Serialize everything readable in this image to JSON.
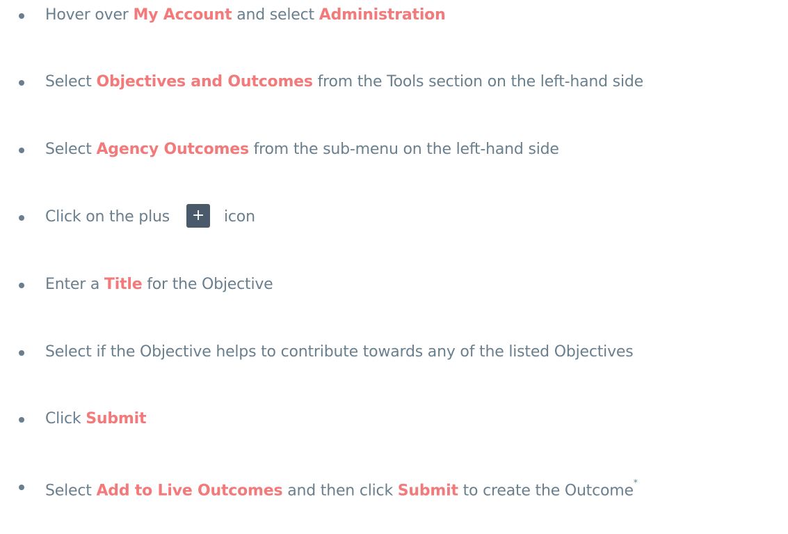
{
  "steps": [
    {
      "pre": "Hover over ",
      "hl1": "My Account",
      "mid": " and select ",
      "hl2": "Administration"
    },
    {
      "pre": "Select ",
      "hl1": "Objectives and Outcomes",
      "post": " from the Tools section on the left-hand side"
    },
    {
      "pre": "Select ",
      "hl1": "Agency Outcomes",
      "post": " from the sub-menu on the left-hand side"
    },
    {
      "pre": "Click on the plus",
      "icon_glyph": "+",
      "icon_name": "plus-icon",
      "post": "icon"
    },
    {
      "pre": "Enter a ",
      "hl1": "Title",
      "post": " for the Objective"
    },
    {
      "text": "Select if the Objective helps to contribute towards any of the listed Objectives"
    },
    {
      "pre": "Click ",
      "hl1": "Submit"
    },
    {
      "pre": "Select ",
      "hl1": "Add to Live Outcomes",
      "mid": " and then click ",
      "hl2": "Submit",
      "post": " to create the Outcome",
      "footnote": "*"
    }
  ],
  "colors": {
    "text": "#6a7f8e",
    "highlight": "#f37a7a",
    "icon_bg": "#4a5a6a",
    "background": "#ffffff"
  }
}
